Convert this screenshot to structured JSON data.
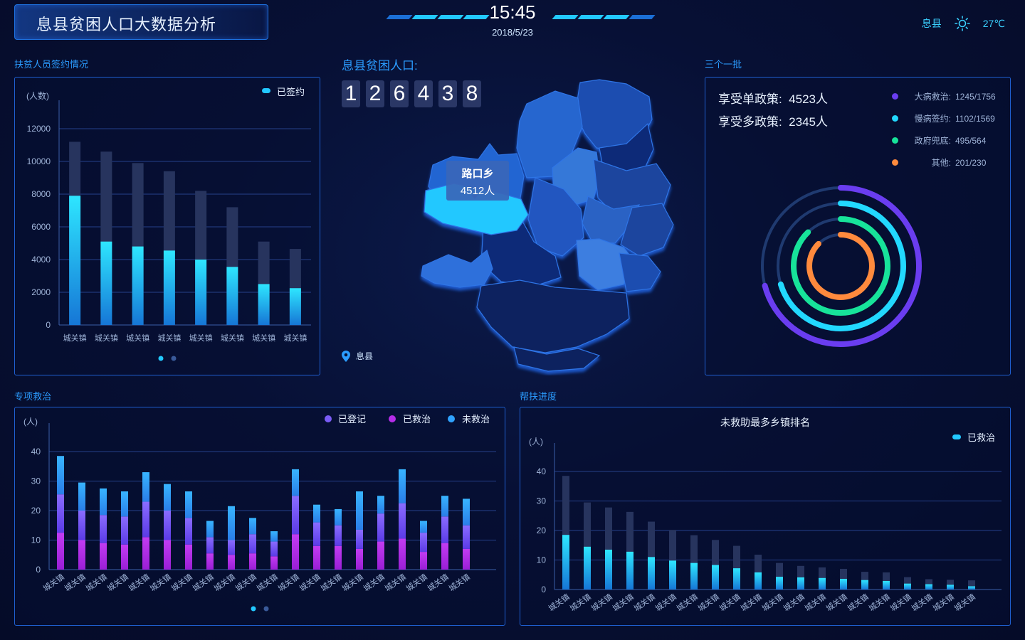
{
  "header": {
    "title": "息县贫困人口大数据分析",
    "time": "15:45",
    "date": "2018/5/23",
    "location": "息县",
    "temperature": "27℃"
  },
  "colors": {
    "accent": "#2b9cff",
    "cyan": "#22c8ff",
    "panel_border": "#1f5fd0",
    "purple": "#6a3df0",
    "magenta": "#b52de8",
    "green": "#17e39a",
    "orange": "#ff8a3d"
  },
  "sign_panel": {
    "section_title": "扶贫人员签约情况",
    "unit": "(人数)",
    "legend": "已签约"
  },
  "map_panel": {
    "title": "息县贫困人口:",
    "digits": [
      "1",
      "2",
      "6",
      "4",
      "3",
      "8"
    ],
    "tooltip_name": "路口乡",
    "tooltip_value": "4512人",
    "location_label": "息县"
  },
  "batch_panel": {
    "section_title": "三个一批",
    "single_policy": "享受单政策:  4523人",
    "multi_policy": "享受多政策:  2345人",
    "legend": [
      {
        "label": "大病救治:",
        "value": "1245/1756",
        "color": "#6a3df0"
      },
      {
        "label": "慢病签约:",
        "value": "1102/1569",
        "color": "#22d8ff"
      },
      {
        "label": "政府兜底:",
        "value": "495/564",
        "color": "#17e39a"
      },
      {
        "label": "其他:",
        "value": "201/230",
        "color": "#ff8a3d"
      }
    ]
  },
  "treat_panel": {
    "section_title": "专项救治",
    "unit": "(人)",
    "legend": [
      "已登记",
      "已救治",
      "未救治"
    ]
  },
  "progress_panel": {
    "section_title": "帮扶进度",
    "chart_title": "未救助最多乡镇排名",
    "unit": "(人)",
    "legend": "已救治"
  },
  "chart_data": [
    {
      "id": "sign",
      "type": "bar",
      "categories": [
        "城关镇",
        "城关镇",
        "城关镇",
        "城关镇",
        "城关镇",
        "城关镇",
        "城关镇",
        "城关镇"
      ],
      "series": [
        {
          "name": "已签约",
          "values": [
            7900,
            5100,
            4800,
            4550,
            4000,
            3550,
            2500,
            2250
          ]
        },
        {
          "values": [
            11200,
            10600,
            9900,
            9400,
            8200,
            7200,
            5100,
            4650
          ]
        }
      ],
      "ylim": [
        0,
        12000
      ],
      "yticks": [
        0,
        2000,
        4000,
        6000,
        8000,
        10000,
        12000
      ]
    },
    {
      "id": "treat",
      "type": "bar",
      "stacked": true,
      "categories": [
        "城关镇",
        "城关镇",
        "城关镇",
        "城关镇",
        "城关镇",
        "城关镇",
        "城关镇",
        "城关镇",
        "城关镇",
        "城关镇",
        "城关镇",
        "城关镇",
        "城关镇",
        "城关镇",
        "城关镇",
        "城关镇",
        "城关镇",
        "城关镇",
        "城关镇",
        "城关镇"
      ],
      "series": [
        {
          "name": "已救治",
          "values": [
            12.5,
            10,
            9,
            8.5,
            11,
            10,
            8.5,
            5.5,
            5,
            5.5,
            4.5,
            12,
            8,
            8,
            7,
            9.5,
            10.5,
            6,
            9,
            7
          ]
        },
        {
          "name": "已登记",
          "values": [
            13,
            10,
            9.5,
            9.5,
            12,
            10,
            9,
            5.5,
            5,
            6.5,
            5,
            13,
            8,
            7,
            6.5,
            9.5,
            12,
            6.5,
            9,
            8
          ]
        },
        {
          "name": "未救治",
          "values": [
            13,
            9.5,
            9,
            8.5,
            10,
            9,
            9,
            5.5,
            11.5,
            5.5,
            3.5,
            9,
            6,
            5.5,
            13,
            6,
            11.5,
            4,
            7,
            9
          ]
        }
      ],
      "ylim": [
        0,
        40
      ],
      "yticks": [
        0,
        10,
        20,
        30,
        40
      ]
    },
    {
      "id": "progress",
      "type": "bar",
      "categories": [
        "城关镇",
        "城关镇",
        "城关镇",
        "城关镇",
        "城关镇",
        "城关镇",
        "城关镇",
        "城关镇",
        "城关镇",
        "城关镇",
        "城关镇",
        "城关镇",
        "城关镇",
        "城关镇",
        "城关镇",
        "城关镇",
        "城关镇",
        "城关镇",
        "城关镇",
        "城关镇"
      ],
      "series": [
        {
          "name": "已救治",
          "values": [
            18.5,
            14.5,
            13.5,
            12.8,
            11,
            9.8,
            9,
            8.3,
            7.2,
            5.8,
            4.3,
            4.1,
            3.9,
            3.6,
            3.2,
            2.9,
            2,
            1.8,
            1.6,
            1.1
          ]
        },
        {
          "values": [
            38.5,
            29.5,
            27.8,
            26.3,
            23,
            20.2,
            18.4,
            16.8,
            14.8,
            11.8,
            9,
            8,
            7.5,
            7,
            6,
            5.8,
            4.2,
            3.5,
            3.3,
            3.1
          ]
        }
      ],
      "ylim": [
        0,
        40
      ],
      "yticks": [
        0,
        10,
        20,
        30,
        40
      ]
    },
    {
      "id": "rings",
      "type": "pie",
      "categories": [
        "大病救治",
        "慢病签约",
        "政府兜底",
        "其他"
      ],
      "values": [
        1245,
        1102,
        495,
        201
      ],
      "totals": [
        1756,
        1569,
        564,
        230
      ]
    }
  ]
}
